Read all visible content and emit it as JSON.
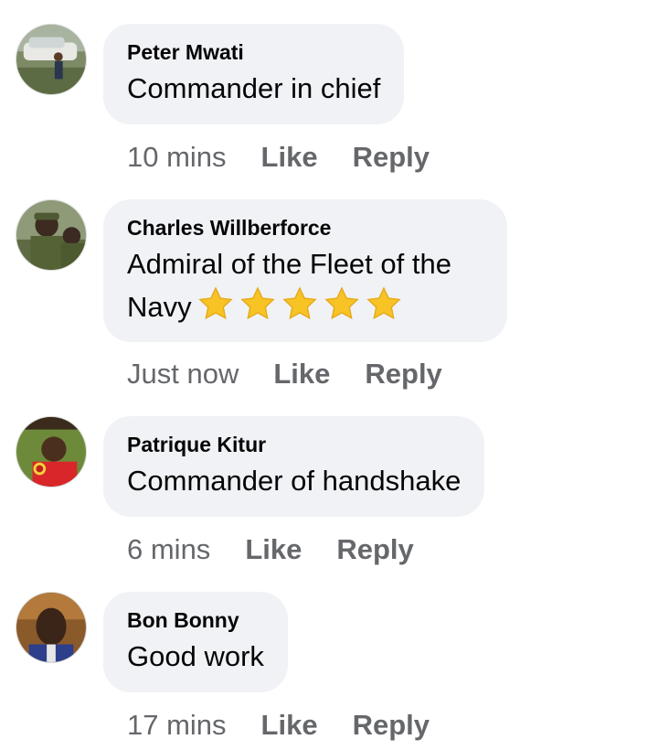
{
  "comments": [
    {
      "author": "Peter Mwati",
      "text": "Commander in chief",
      "time": "10 mins",
      "like_label": "Like",
      "reply_label": "Reply"
    },
    {
      "author": "Charles Willberforce",
      "text_line1": "Admiral of the Fleet of the",
      "text_line2": "Navy",
      "emoji": "star-emoji x5",
      "time": "Just now",
      "like_label": "Like",
      "reply_label": "Reply"
    },
    {
      "author": "Patrique Kitur",
      "text": "Commander of handshake",
      "time": "6 mins",
      "like_label": "Like",
      "reply_label": "Reply"
    },
    {
      "author": "Bon Bonny",
      "text": "Good work",
      "time": "17 mins",
      "like_label": "Like",
      "reply_label": "Reply"
    }
  ],
  "colors": {
    "bubble_bg": "#f0f2f5",
    "meta_text": "#65676b",
    "body_text": "#050505",
    "star": "#f7c325"
  }
}
